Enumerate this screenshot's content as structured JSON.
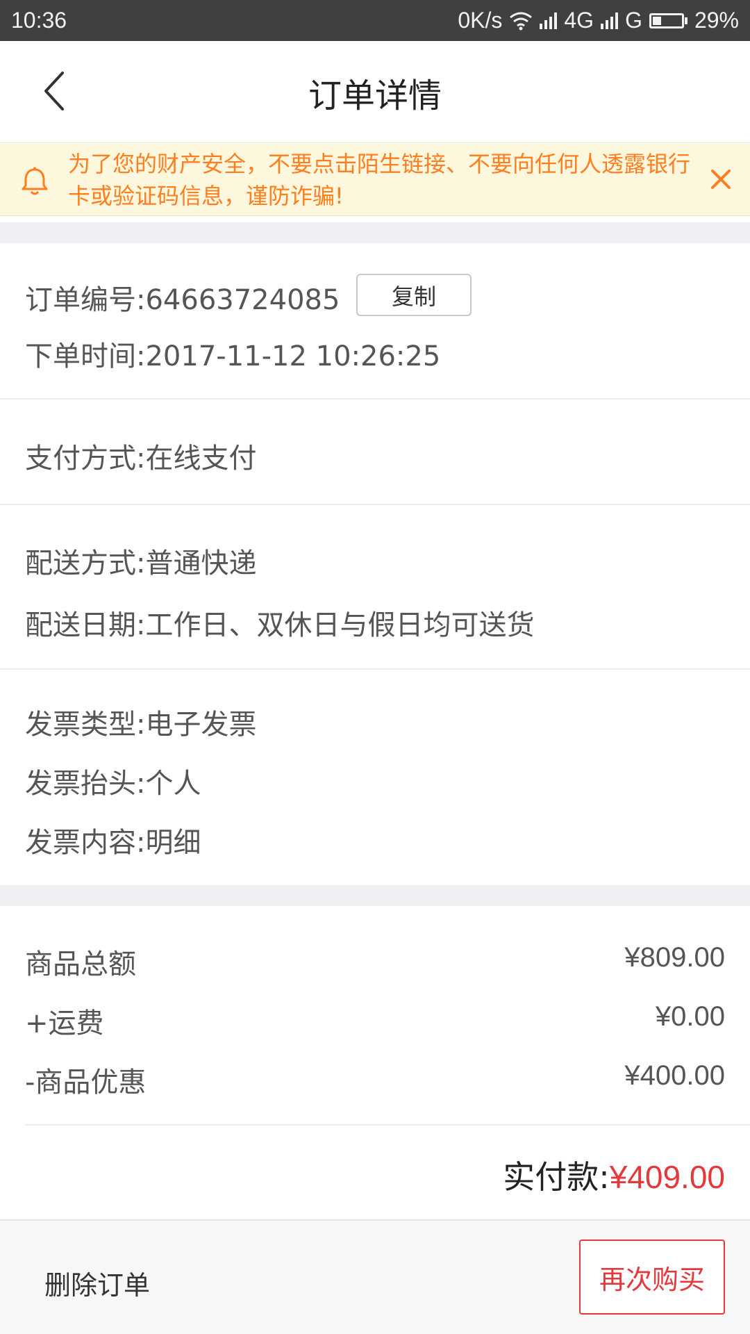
{
  "status_bar": {
    "time": "10:36",
    "net_speed": "0K/s",
    "network_4g": "4G",
    "network_g": "G",
    "battery": "29%",
    "battery_level": 0.29
  },
  "header": {
    "title": "订单详情"
  },
  "notice": {
    "text": "为了您的财产安全，不要点击陌生链接、不要向任何人透露银行卡或验证码信息，谨防诈骗!",
    "color": "#ff7e1f"
  },
  "order": {
    "number_line": "订单编号:64663724085",
    "copy_label": "复制",
    "time_line": "下单时间:2017-11-12  10:26:25"
  },
  "payment": {
    "method_line": "支付方式:在线支付"
  },
  "delivery": {
    "method_line": "配送方式:普通快递",
    "date_line": "配送日期:工作日、双休日与假日均可送货"
  },
  "invoice": {
    "type_line": "发票类型:电子发票",
    "title_line": "发票抬头:个人",
    "content_line": "发票内容:明细"
  },
  "amounts": {
    "rows": [
      {
        "label": "商品总额",
        "value": "¥809.00"
      },
      {
        "label": "+运费",
        "value": "¥0.00"
      },
      {
        "label": "-商品优惠",
        "value": "¥400.00"
      }
    ],
    "total_label": "实付款:",
    "total_value": "¥409.00",
    "accent_color": "#e4393c"
  },
  "actions": {
    "delete_label": "删除订单",
    "buy_again_label": "再次购买"
  }
}
